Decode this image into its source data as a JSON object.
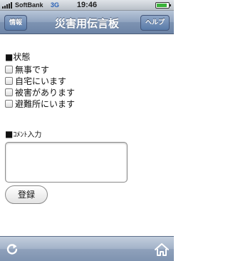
{
  "status_bar": {
    "carrier": "SoftBank",
    "network": "3G",
    "time": "19:46",
    "battery_level": 0.9
  },
  "nav": {
    "title": "災害用伝言板",
    "left_button": "情報",
    "right_button": "ヘルプ"
  },
  "status_section": {
    "title": "■状態",
    "options": [
      {
        "label": "無事です",
        "checked": false
      },
      {
        "label": "自宅にいます",
        "checked": false
      },
      {
        "label": "被害があります",
        "checked": false
      },
      {
        "label": "避難所にいます",
        "checked": false
      }
    ]
  },
  "comment_section": {
    "title_mark": "■",
    "title_text": "ｺﾒﾝﾄ入力",
    "value": ""
  },
  "register_button": "登録",
  "toolbar": {
    "left_icon": "reload-icon",
    "right_icon": "home-icon"
  },
  "colors": {
    "nav_bar": "#7d93b2",
    "toolbar": "#8fa1bb",
    "network_label": "#2a62b8",
    "battery_fill": "#3bb33b"
  }
}
